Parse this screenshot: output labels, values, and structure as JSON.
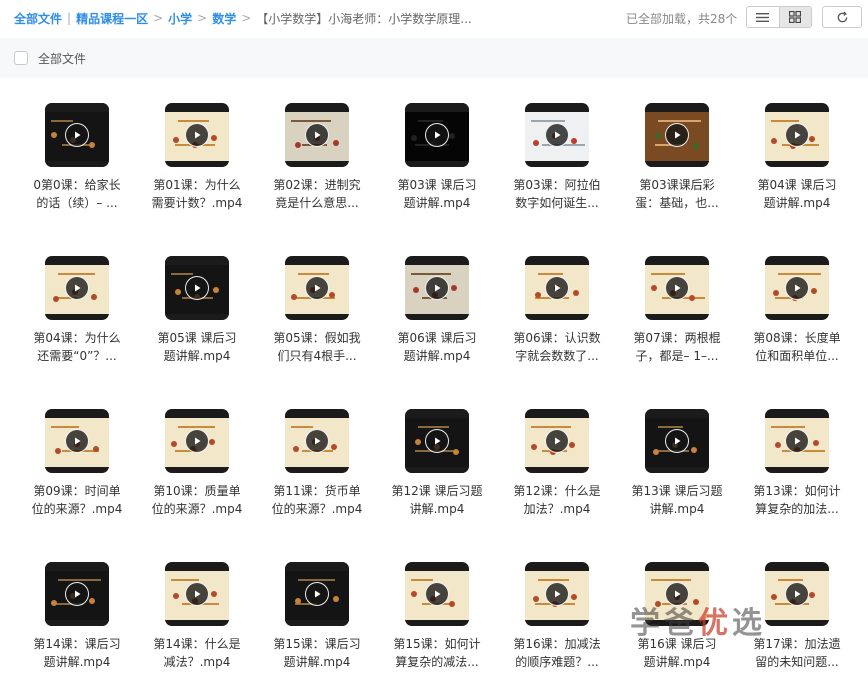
{
  "breadcrumb": [
    "全部文件",
    "精品课程一区",
    "小学",
    "数学",
    "【小学数学】小海老师：小学数学原理..."
  ],
  "status": "已全部加载，共28个",
  "header": {
    "select_all_label": "全部文件"
  },
  "watermark": {
    "text": "学爸",
    "accent": "优",
    "text_end": "选"
  },
  "colors": {
    "link": "#2f8ee8",
    "header_bg": "#f7f8fa"
  },
  "files": [
    {
      "line1": "0第0课：给家长",
      "line2": "的话（续）– ...",
      "theme": "dark"
    },
    {
      "line1": "第01课：为什么",
      "line2": "需要计数？.mp4",
      "theme": "cream"
    },
    {
      "line1": "第02课：进制究",
      "line2": "竟是什么意思...",
      "theme": "grey"
    },
    {
      "line1": "第03课 课后习",
      "line2": "题讲解.mp4",
      "theme": "black"
    },
    {
      "line1": "第03课：阿拉伯",
      "line2": "数字如何诞生...",
      "theme": "light"
    },
    {
      "line1": "第03课课后彩",
      "line2": "蛋：基础，也...",
      "theme": "photo"
    },
    {
      "line1": "第04课 课后习",
      "line2": "题讲解.mp4",
      "theme": "cream"
    },
    {
      "line1": "第04课：为什么",
      "line2": "还需要“0”？...",
      "theme": "cream"
    },
    {
      "line1": "第05课 课后习",
      "line2": "题讲解.mp4",
      "theme": "dark"
    },
    {
      "line1": "第05课：假如我",
      "line2": "们只有4根手...",
      "theme": "cream"
    },
    {
      "line1": "第06课 课后习",
      "line2": "题讲解.mp4",
      "theme": "grey"
    },
    {
      "line1": "第06课：认识数",
      "line2": "字就会数数了...",
      "theme": "cream"
    },
    {
      "line1": "第07课：两根棍",
      "line2": "子，都是– 1–...",
      "theme": "cream"
    },
    {
      "line1": "第08课：长度单",
      "line2": "位和面积单位...",
      "theme": "cream"
    },
    {
      "line1": "第09课：时间单",
      "line2": "位的来源？.mp4",
      "theme": "cream"
    },
    {
      "line1": "第10课：质量单",
      "line2": "位的来源？.mp4",
      "theme": "cream"
    },
    {
      "line1": "第11课：货币单",
      "line2": "位的来源？.mp4",
      "theme": "cream"
    },
    {
      "line1": "第12课 课后习题",
      "line2": "讲解.mp4",
      "theme": "dark"
    },
    {
      "line1": "第12课：什么是",
      "line2": "加法？.mp4",
      "theme": "cream"
    },
    {
      "line1": "第13课 课后习题",
      "line2": "讲解.mp4",
      "theme": "dark"
    },
    {
      "line1": "第13课：如何计",
      "line2": "算复杂的加法...",
      "theme": "cream"
    },
    {
      "line1": "第14课：课后习",
      "line2": "题讲解.mp4",
      "theme": "dark"
    },
    {
      "line1": "第14课：什么是",
      "line2": "减法？.mp4",
      "theme": "cream"
    },
    {
      "line1": "第15课：课后习",
      "line2": "题讲解.mp4",
      "theme": "dark"
    },
    {
      "line1": "第15课：如何计",
      "line2": "算复杂的减法...",
      "theme": "cream"
    },
    {
      "line1": "第16课：加减法",
      "line2": "的顺序难题？...",
      "theme": "cream"
    },
    {
      "line1": "第16课 课后习",
      "line2": "题讲解.mp4",
      "theme": "cream"
    },
    {
      "line1": "第17课：加法遗",
      "line2": "留的未知问题...",
      "theme": "cream"
    }
  ]
}
